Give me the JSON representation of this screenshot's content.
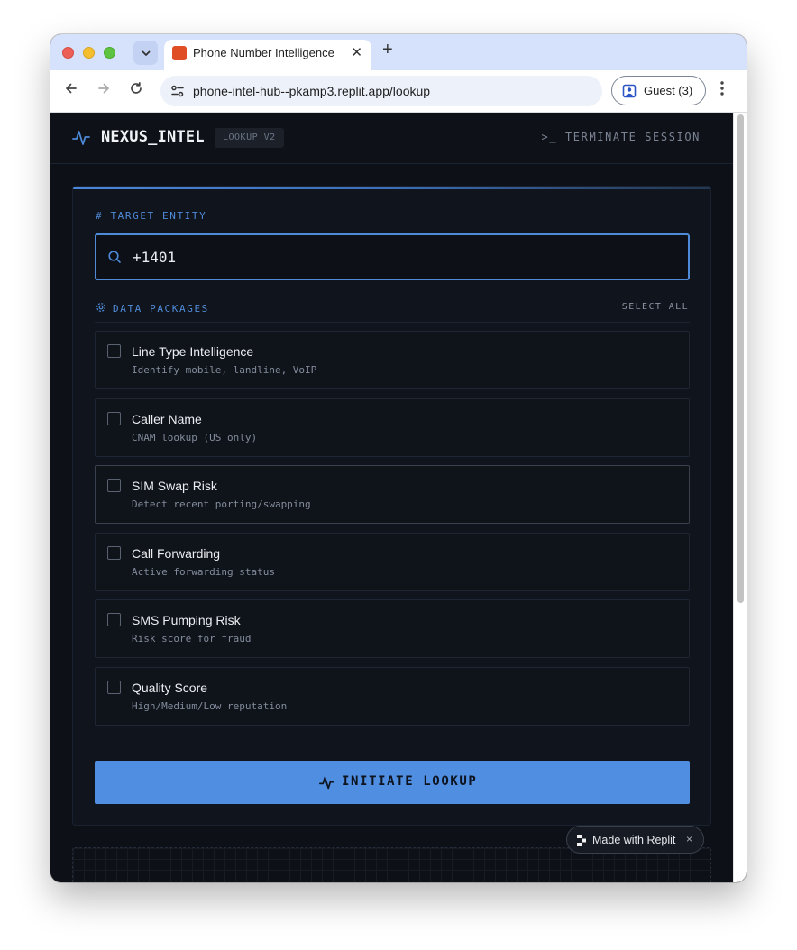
{
  "browser": {
    "tab_title": "Phone Number Intelligence",
    "tab_close": "✕",
    "new_tab": "+",
    "url": "phone-intel-hub--pkamp3.replit.app/lookup",
    "profile_label": "Guest (3)"
  },
  "header": {
    "brand": "NEXUS_INTEL",
    "version": "LOOKUP_V2",
    "terminate_label": ">_ TERMINATE SESSION"
  },
  "form": {
    "target_label": "# TARGET ENTITY",
    "search_value": "+1401",
    "packages_label": "DATA PACKAGES",
    "select_all": "SELECT ALL",
    "packages": [
      {
        "title": "Line Type Intelligence",
        "desc": "Identify mobile, landline, VoIP",
        "checked": false
      },
      {
        "title": "Caller Name",
        "desc": "CNAM lookup (US only)",
        "checked": false
      },
      {
        "title": "SIM Swap Risk",
        "desc": "Detect recent porting/swapping",
        "checked": false
      },
      {
        "title": "Call Forwarding",
        "desc": "Active forwarding status",
        "checked": false
      },
      {
        "title": "SMS Pumping Risk",
        "desc": "Risk score for fraud",
        "checked": false
      },
      {
        "title": "Quality Score",
        "desc": "High/Medium/Low reputation",
        "checked": false
      }
    ],
    "submit_label": "INITIATE LOOKUP"
  },
  "replit_badge": {
    "label": "Made with Replit",
    "close": "×"
  },
  "colors": {
    "accent": "#4f8ee0",
    "background": "#0d1016",
    "card": "#10141c"
  }
}
